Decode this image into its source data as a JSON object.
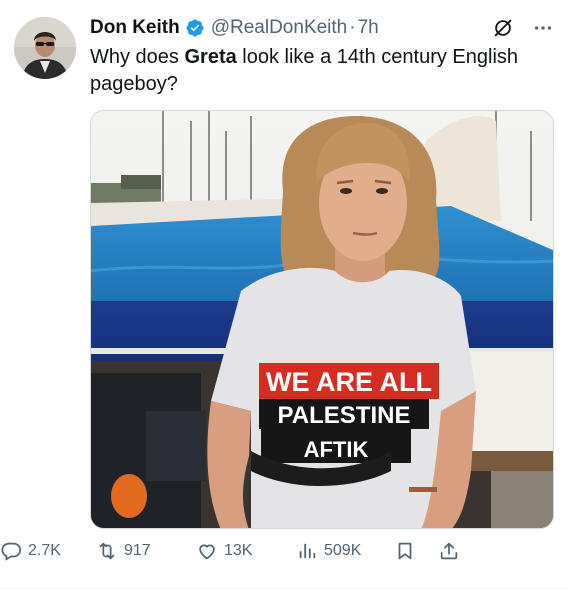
{
  "author": {
    "name": "Don Keith",
    "handle": "@RealDonKeith",
    "separator": "·",
    "time": "7h",
    "verified_color": "#1d9bf0"
  },
  "tweet": {
    "text_before": "Why does ",
    "text_bold": "Greta",
    "text_after": " look like a 14th century English pageboy?"
  },
  "media": {
    "shirt_line1": "WE ARE ALL",
    "shirt_line2": "PALESTINE",
    "shirt_line3": "AFTIK"
  },
  "actions": {
    "replies": "2.7K",
    "reposts": "917",
    "likes": "13K",
    "views": "509K"
  },
  "icons": [
    "verified-badge-icon",
    "grok-icon",
    "more-icon",
    "reply-icon",
    "retweet-icon",
    "like-icon",
    "views-icon",
    "bookmark-icon",
    "share-icon"
  ],
  "colors": {
    "text_primary": "#0f1419",
    "text_secondary": "#536471",
    "accent": "#1d9bf0"
  }
}
